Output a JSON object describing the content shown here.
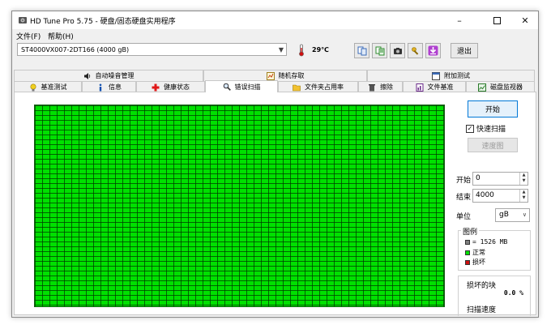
{
  "window": {
    "title": "HD Tune Pro 5.75 - 硬盘/固态硬盘实用程序"
  },
  "menu": {
    "file": "文件(F)",
    "help": "帮助(H)"
  },
  "toolbar": {
    "drive": "ST4000VX007-2DT166 (4000 gB)",
    "temperature": "29℃",
    "exit_label": "退出",
    "icons": [
      "copy-icon",
      "copy-text-icon",
      "camera-icon",
      "options-icon",
      "save-icon"
    ]
  },
  "tabs_top": [
    {
      "label": "自动噪音管理",
      "icon": "speaker-icon"
    },
    {
      "label": "随机存取",
      "icon": "random-access-icon"
    },
    {
      "label": "附加测试",
      "icon": "extra-tests-icon"
    }
  ],
  "tabs_bottom": [
    {
      "label": "基准测试",
      "icon": "bulb-icon"
    },
    {
      "label": "信息",
      "icon": "info-icon"
    },
    {
      "label": "健康状态",
      "icon": "health-cross-icon"
    },
    {
      "label": "错误扫描",
      "icon": "magnifier-icon",
      "active": true
    },
    {
      "label": "文件夹占用率",
      "icon": "folder-icon"
    },
    {
      "label": "擦除",
      "icon": "trash-icon"
    },
    {
      "label": "文件基准",
      "icon": "file-benchmark-icon"
    },
    {
      "label": "磁盘监视器",
      "icon": "disk-monitor-icon"
    }
  ],
  "scan": {
    "start_button": "开始",
    "quick_scan_label": "快速扫描",
    "quick_scan_checked": true,
    "speed_map_button": "速度图",
    "start_label": "开始",
    "start_value": "0",
    "end_label": "结束",
    "end_value": "4000",
    "unit_label": "单位",
    "unit_value": "gB",
    "legend_title": "图例",
    "legend_block": "= 1526 MB",
    "legend_ok": "正常",
    "legend_bad": "损坏",
    "damaged_title": "损坏的块",
    "damaged_value": "0.0 %",
    "speed_title": "扫描速度",
    "all_blocks_status": "正常",
    "colors": {
      "ok": "#00e000",
      "bad": "#d01010",
      "block": "#808080"
    }
  }
}
